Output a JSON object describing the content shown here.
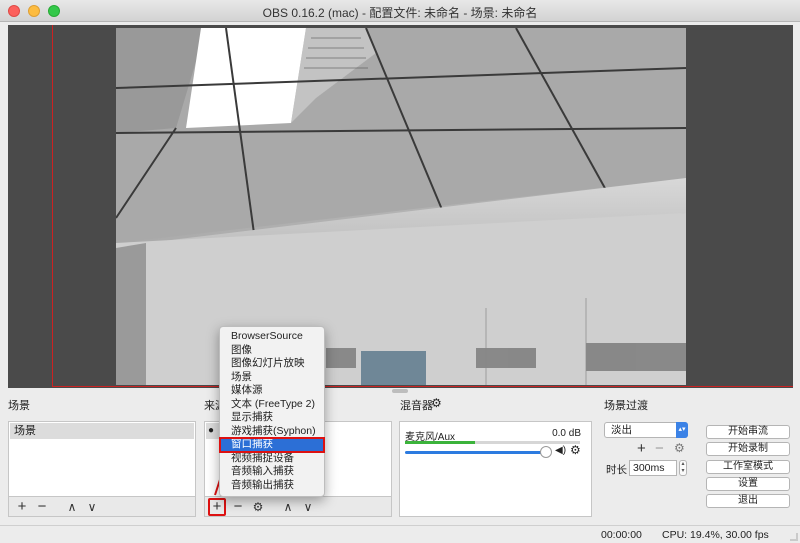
{
  "window": {
    "title": "OBS 0.16.2 (mac) - 配置文件: 未命名 - 场景: 未命名"
  },
  "scenes": {
    "title": "场景",
    "items": [
      "场景"
    ]
  },
  "sources": {
    "title": "来源"
  },
  "context_menu": {
    "items": [
      "BrowserSource",
      "图像",
      "图像幻灯片放映",
      "场景",
      "媒体源",
      "文本 (FreeType 2)",
      "显示捕获",
      "游戏捕获(Syphon)",
      "窗口捕获",
      "视频捕捉设备",
      "音频输入捕获",
      "音频输出捕获"
    ],
    "selected": "窗口捕获"
  },
  "mixer": {
    "title": "混音器",
    "channel": "麦克风/Aux",
    "level": "0.0 dB",
    "meter_fraction": 0.4,
    "volume_fraction": 1.0
  },
  "transitions": {
    "title": "场景过渡",
    "selected": "淡出",
    "duration_label": "时长",
    "duration_value": "300ms"
  },
  "controls": {
    "start_stream": "开始串流",
    "start_record": "开始录制",
    "studio_mode": "工作室模式",
    "settings": "设置",
    "exit": "退出"
  },
  "status": {
    "time": "00:00:00",
    "cpu": "CPU: 19.4%, 30.00 fps"
  },
  "icons": {
    "add": "+",
    "remove": "−",
    "up": "∧",
    "down": "∨",
    "gear": "⚙",
    "eye": "👁",
    "speaker": "🔊"
  },
  "colors": {
    "accent": "#2c6fd6",
    "highlight": "#d11111"
  }
}
